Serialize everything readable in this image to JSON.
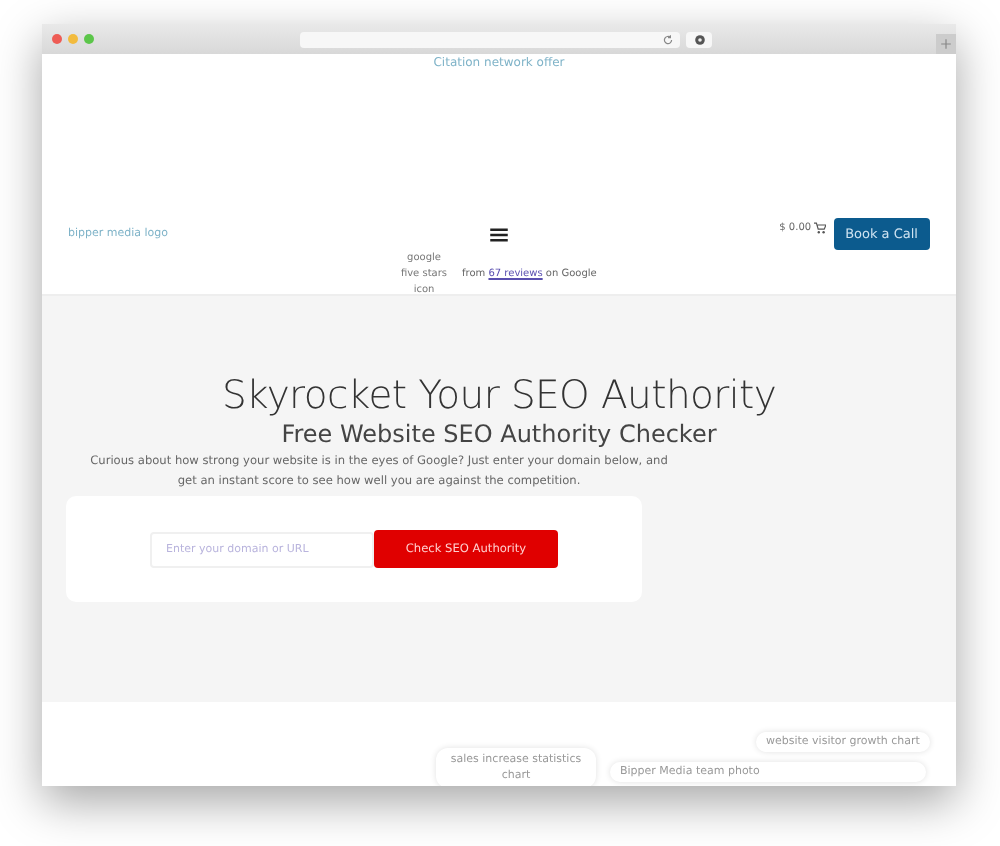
{
  "browser": {
    "buttons": [
      {
        "color": "#ee5c55"
      },
      {
        "color": "#f2bb3e"
      },
      {
        "color": "#5cc64a"
      }
    ]
  },
  "top_link": "Citation network offer",
  "header": {
    "logo_alt": "bipper media logo",
    "cart": "$ 0.00",
    "cta": "Book a Call"
  },
  "reviews": {
    "stars_alt": "google five stars icon",
    "prefix": "from",
    "link": "67 reviews",
    "suffix": "on Google"
  },
  "hero": {
    "title": "Skyrocket Your SEO Authority",
    "subtitle": "Free Website SEO Authority Checker",
    "description": "Curious about how strong your website is in the eyes of Google? Just enter your domain below, and get an instant score to see how well you are against the competition.",
    "input": {
      "placeholder": "Enter your domain or URL"
    },
    "button": "Check SEO Authority"
  },
  "images": [
    {
      "alt": "website visitor growth chart"
    },
    {
      "alt": "sales increase statistics chart"
    },
    {
      "alt": "Bipper Media team photo"
    }
  ]
}
